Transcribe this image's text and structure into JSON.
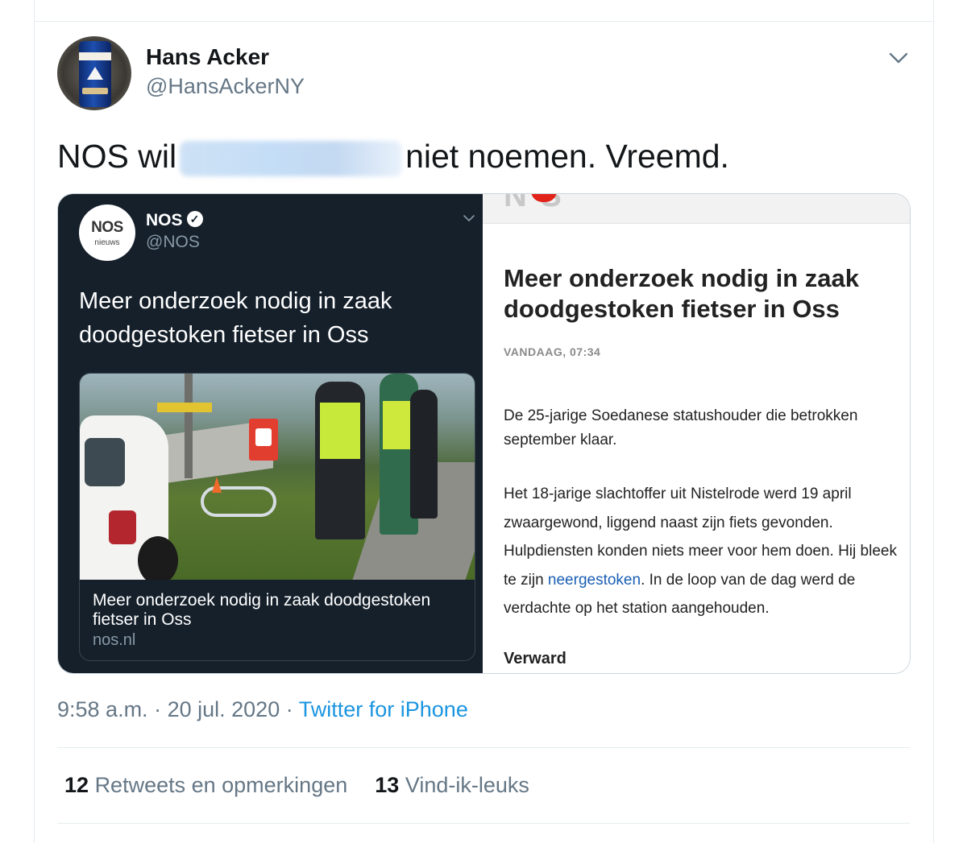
{
  "tweet": {
    "author_name": "Hans Acker",
    "author_handle": "@HansAckerNY",
    "text_before": "NOS wil",
    "text_after": "niet noemen. Vreemd.",
    "time": "9:58 a.m.",
    "separator1": "·",
    "date": "20 jul. 2020",
    "separator2": "·",
    "source": "Twitter for iPhone"
  },
  "quoted": {
    "logo_text": "NOS",
    "logo_sub": "nieuws",
    "name": "NOS",
    "verified_glyph": "✓",
    "handle": "@NOS",
    "title": "Meer onderzoek nodig in zaak doodgestoken fietser in Oss",
    "card_title": "Meer onderzoek nodig in zaak doodgestoken fietser in Oss",
    "card_domain": "nos.nl"
  },
  "article": {
    "title": "Meer onderzoek nodig in zaak doodgestoken fietser in Oss",
    "date": "VANDAAG, 07:34",
    "paragraph1_line1": "De 25-jarige Soedanese statushouder die betrokken",
    "paragraph1_line2": "september klaar.",
    "paragraph2_before": "Het 18-jarige slachtoffer uit Nistelrode werd 19 april zwaargewond, liggend naast zijn fiets gevonden. Hulpdiensten konden niets meer voor hem doen. Hij bleek te zijn ",
    "paragraph2_link": "neergestoken",
    "paragraph2_after": ". In de loop van de dag werd de verdachte op het station aangehouden.",
    "subheading": "Verward"
  },
  "stats": {
    "retweets_count": "12",
    "retweets_label": "Retweets en opmerkingen",
    "likes_count": "13",
    "likes_label": "Vind-ik-leuks"
  },
  "icons": {
    "menu": "chevron-down-icon",
    "verified": "verified-badge-icon"
  },
  "colors": {
    "link": "#1b95e0",
    "dark_card": "#15202b",
    "muted": "#657786"
  }
}
